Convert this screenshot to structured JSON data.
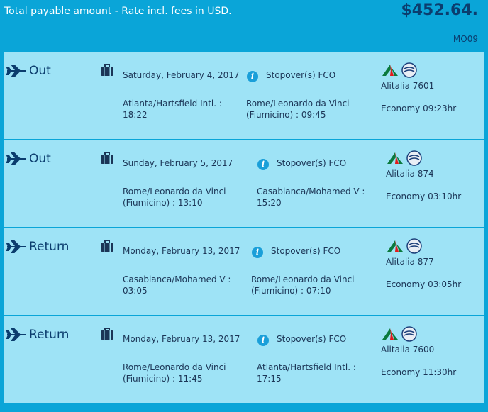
{
  "header": {
    "label": "Total payable amount - Rate incl. fees in USD.",
    "total": "$452.64.",
    "ref": "MO09"
  },
  "colors": {
    "accent": "#0aa5d8",
    "panel": "#9ee3f6",
    "text_dark": "#0b3d6e"
  },
  "segments": [
    {
      "direction": "Out",
      "date": "Saturday, February 4, 2017",
      "stopover": "Stopover(s) FCO",
      "departure": "Atlanta/Hartsfield Intl. : 18:22",
      "arrival": "Rome/Leonardo da Vinci (Fiumicino) : 09:45",
      "airline": "Alitalia 7601",
      "cabin": "Economy 09:23hr",
      "icons": [
        "plane-icon",
        "baggage-icon",
        "info-icon",
        "alitalia-logo",
        "skyteam-logo"
      ]
    },
    {
      "direction": "Out",
      "date": "Sunday, February 5, 2017",
      "stopover": "Stopover(s) FCO",
      "departure": "Rome/Leonardo da Vinci (Fiumicino) : 13:10",
      "arrival": "Casablanca/Mohamed V : 15:20",
      "airline": "Alitalia 874",
      "cabin": "Economy 03:10hr",
      "icons": [
        "plane-icon",
        "baggage-icon",
        "info-icon",
        "alitalia-logo",
        "skyteam-logo"
      ]
    },
    {
      "direction": "Return",
      "date": "Monday, February 13, 2017",
      "stopover": "Stopover(s) FCO",
      "departure": "Casablanca/Mohamed V : 03:05",
      "arrival": "Rome/Leonardo da Vinci (Fiumicino) : 07:10",
      "airline": "Alitalia 877",
      "cabin": "Economy 03:05hr",
      "icons": [
        "plane-icon",
        "baggage-icon",
        "info-icon",
        "alitalia-logo",
        "skyteam-logo"
      ]
    },
    {
      "direction": "Return",
      "date": "Monday, February 13, 2017",
      "stopover": "Stopover(s) FCO",
      "departure": "Rome/Leonardo da Vinci (Fiumicino) : 11:45",
      "arrival": "Atlanta/Hartsfield Intl. : 17:15",
      "airline": "Alitalia 7600",
      "cabin": "Economy 11:30hr",
      "icons": [
        "plane-icon",
        "baggage-icon",
        "info-icon",
        "alitalia-logo",
        "skyteam-logo"
      ]
    }
  ]
}
